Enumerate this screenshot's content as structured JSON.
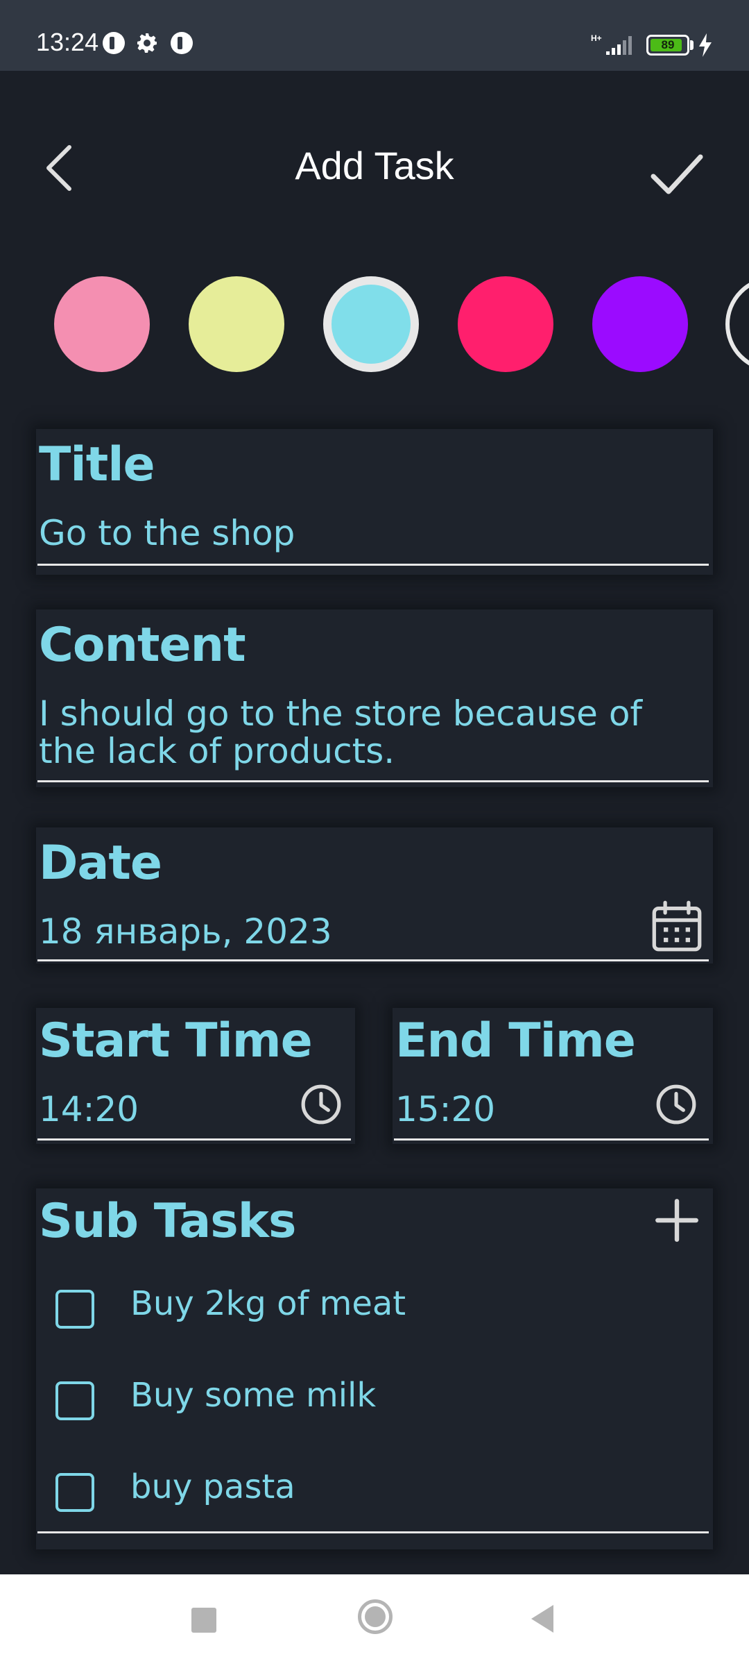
{
  "status_bar": {
    "time": "13:24",
    "network": "H+",
    "battery_level": "89",
    "battery_fraction": 0.89,
    "battery_color": "#4cbb17"
  },
  "header": {
    "title": "Add Task",
    "back_icon": "chevron-left-icon",
    "confirm_icon": "checkmark-icon"
  },
  "colors": {
    "options": [
      "#f48fb1",
      "#e6ed99",
      "#80deea",
      "#ff1f6d",
      "#9b0bff"
    ],
    "selected": "#80deea"
  },
  "form": {
    "title_label": "Title",
    "title_value": "Go to the shop",
    "content_label": "Content",
    "content_value_line1": "I should go to the store because of",
    "content_value_line2": "the lack of products.",
    "date_label": "Date",
    "date_value": "18 январь, 2023",
    "start_time_label": "Start Time",
    "start_time_value": "14:20",
    "end_time_label": "End Time",
    "end_time_value": "15:20"
  },
  "subtasks": {
    "label": "Sub Tasks",
    "items": [
      {
        "label": "Buy 2kg of meat",
        "checked": false
      },
      {
        "label": "Buy some milk",
        "checked": false
      },
      {
        "label": "buy pasta",
        "checked": false
      }
    ]
  },
  "theme": {
    "background": "#1b1f27",
    "accent": "#7fd7e8",
    "card": "#1e232c"
  }
}
